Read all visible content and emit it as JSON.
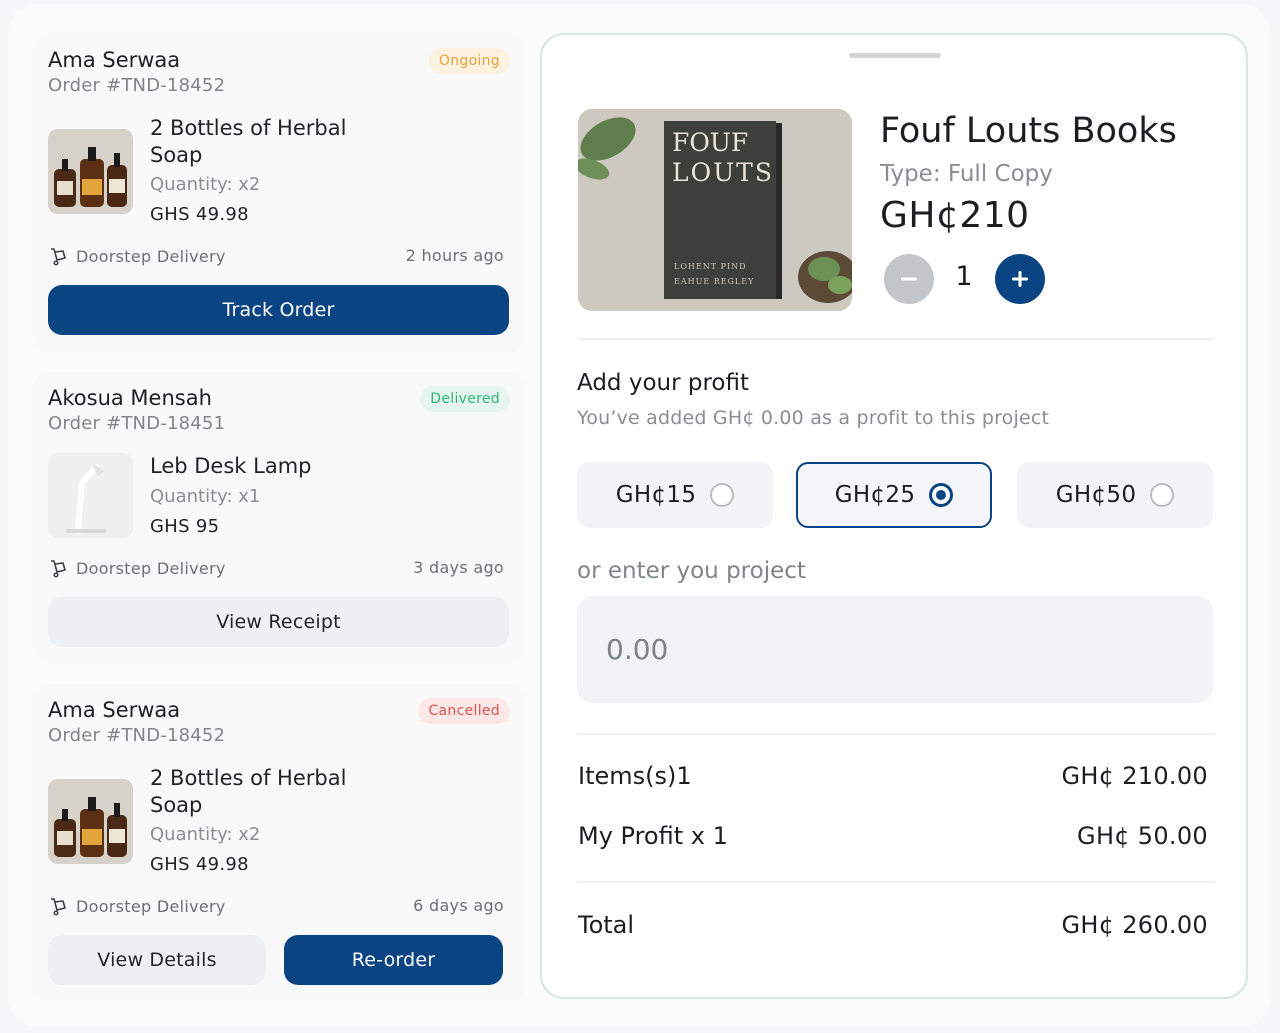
{
  "orders": [
    {
      "customer": "Ama Serwaa",
      "order_no": "Order #TND-18452",
      "status": "Ongoing",
      "item_name": "2 Bottles of Herbal Soap",
      "quantity": "Quantity: x2",
      "price": "GHS 49.98",
      "delivery": "Doorstep Delivery",
      "time": "2 hours ago",
      "button": "Track Order"
    },
    {
      "customer": "Akosua Mensah",
      "order_no": "Order #TND-18451",
      "status": "Delivered",
      "item_name": "Leb Desk Lamp",
      "quantity": "Quantity: x1",
      "price": "GHS 95",
      "delivery": "Doorstep Delivery",
      "time": "3 days ago",
      "button": "View Receipt"
    },
    {
      "customer": "Ama Serwaa",
      "order_no": "Order #TND-18452",
      "status": "Cancelled",
      "item_name": "2 Bottles of Herbal Soap",
      "quantity": "Quantity: x2",
      "price": "GHS 49.98",
      "delivery": "Doorstep Delivery",
      "time": "6 days ago",
      "button_secondary": "View Details",
      "button_primary": "Re-order"
    }
  ],
  "product": {
    "title": "Fouf Louts Books",
    "type": "Type: Full Copy",
    "price": "GH¢210",
    "quantity": "1",
    "cover_title_line1": "FOUF",
    "cover_title_line2": "LOUTS",
    "cover_author_line1": "LOHENT PIND",
    "cover_author_line2": "EAHUE REGLEY"
  },
  "profit": {
    "title": "Add your profit",
    "subtitle": "You’ve added GH¢ 0.00 as a profit to this project",
    "options": [
      "GH¢15",
      "GH¢25",
      "GH¢50"
    ],
    "selected_index": 1,
    "enter_label": "or enter you project",
    "input_placeholder": "0.00"
  },
  "summary": {
    "items_label": "Items(s)1",
    "items_value": "GH¢ 210.00",
    "profit_label": "My Profit x 1",
    "profit_value": "GH¢ 50.00",
    "total_label": "Total",
    "total_value": "GH¢ 260.00"
  },
  "colors": {
    "primary": "#0b4482",
    "ongoing": "#e6a23c",
    "delivered": "#2fb67a",
    "cancelled": "#d9534f"
  }
}
